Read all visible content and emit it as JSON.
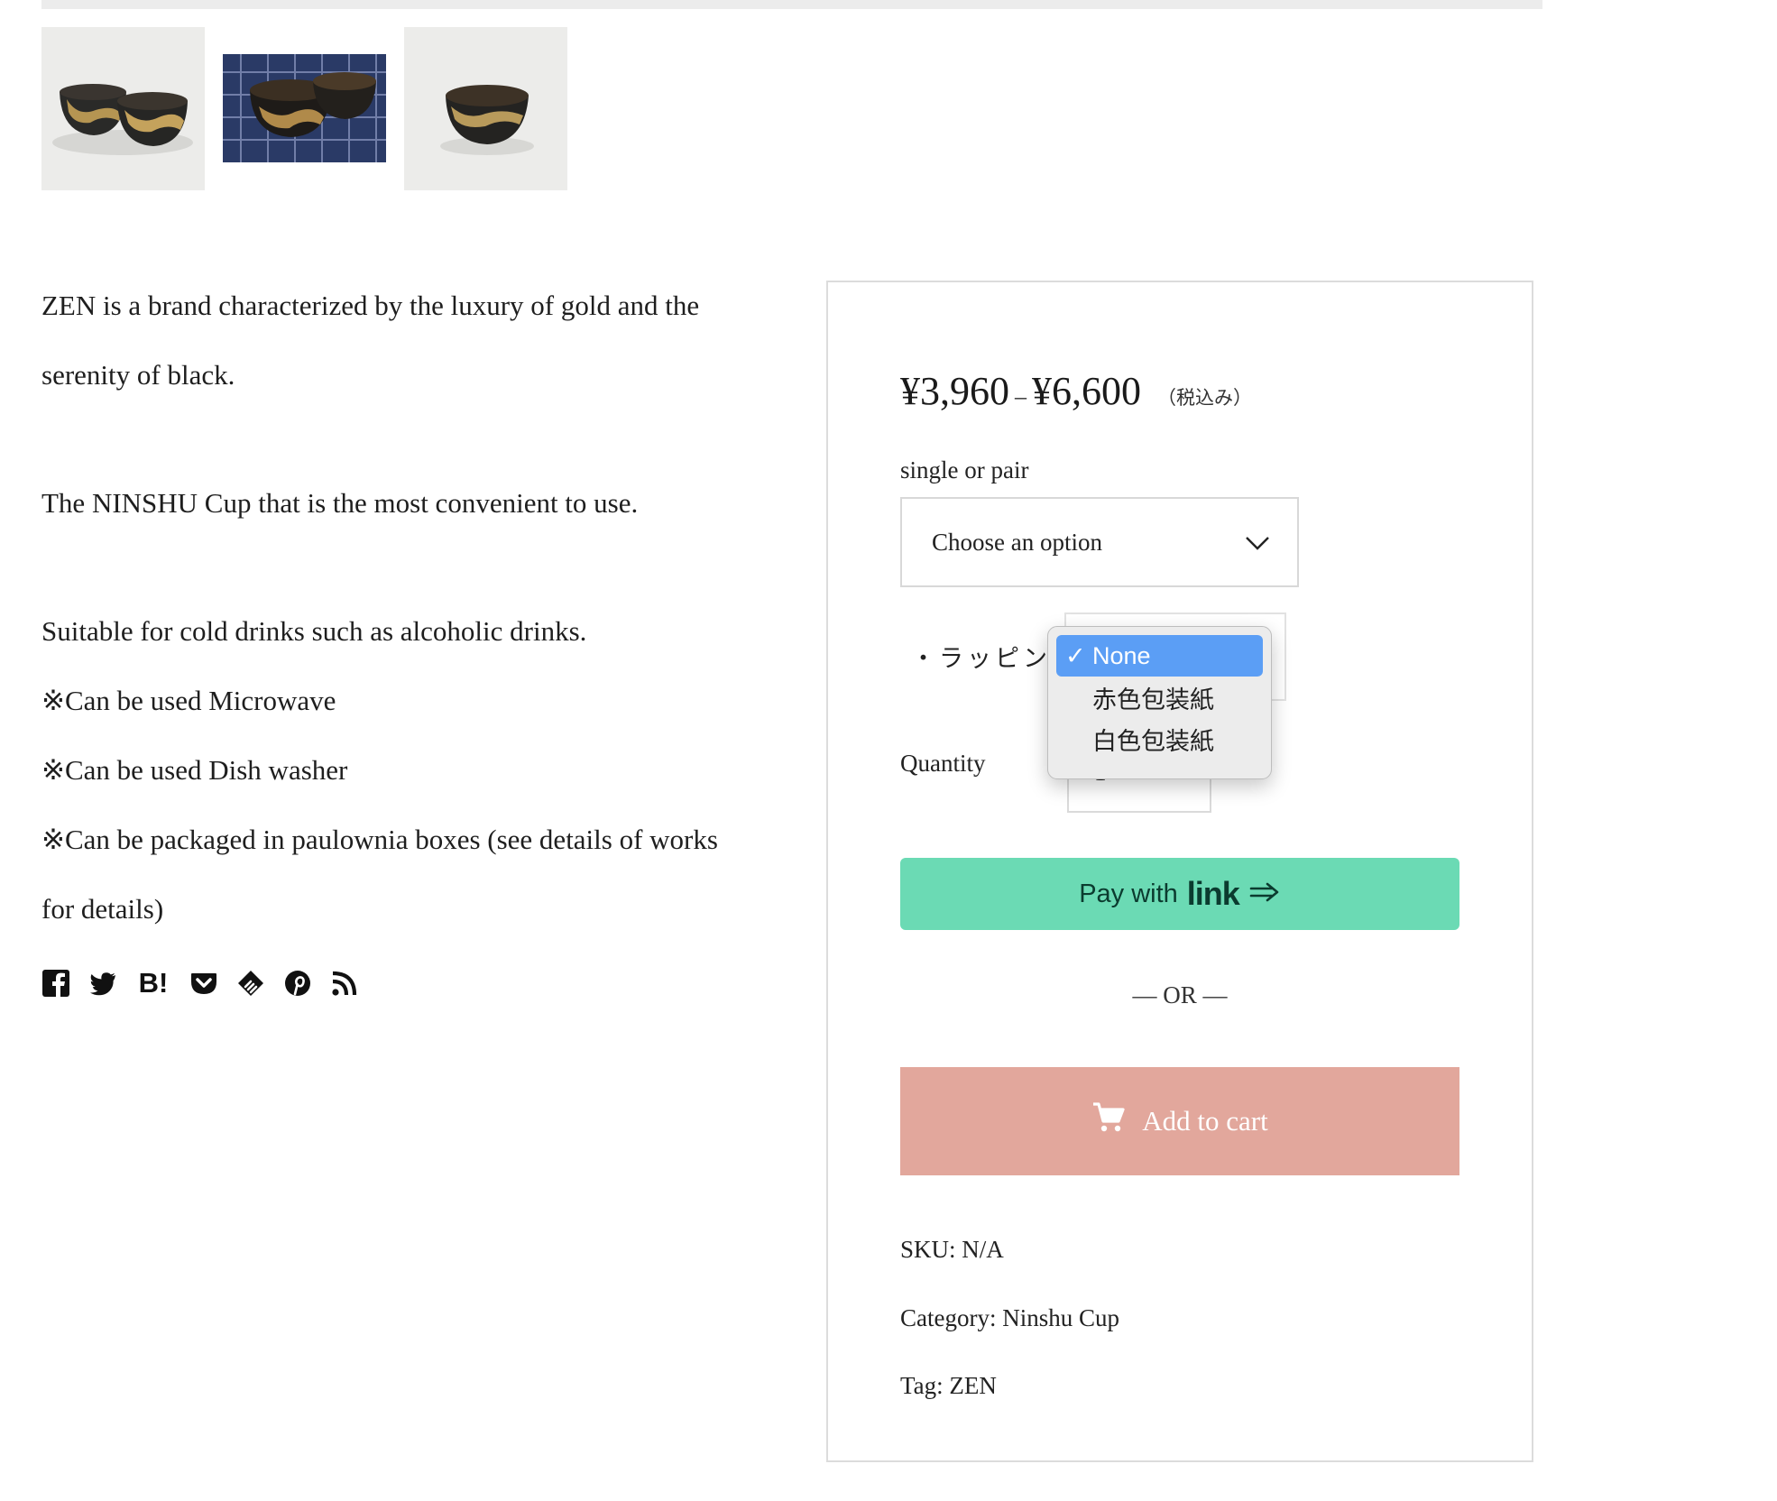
{
  "description": {
    "line1": "ZEN is a brand characterized by the luxury of gold and the",
    "line2": "serenity of black.",
    "line3": "The NINSHU Cup that is the most convenient to use.",
    "line4": "Suitable for cold drinks such as alcoholic drinks.",
    "line5": "※Can be used Microwave",
    "line6": "※Can be used Dish washer",
    "line7": "※Can be packaged in paulownia boxes (see details of works",
    "line8": "for details)"
  },
  "share_icons": [
    "facebook-icon",
    "twitter-icon",
    "hatena-bookmark-icon",
    "pocket-icon",
    "feedly-icon",
    "pinterest-icon",
    "rss-icon"
  ],
  "share": {
    "hatena_text": "B!"
  },
  "product": {
    "price_min": "¥3,960",
    "price_sep": "–",
    "price_max": "¥6,600",
    "tax_note": "（税込み）",
    "variant_label": "single or pair",
    "variant_placeholder": "Choose an option",
    "wrapping_label": "・ラッピング",
    "wrapping_options": [
      "None",
      "赤色包装紙",
      "白色包装紙"
    ],
    "wrapping_selected": "None",
    "checkmark": "✓",
    "quantity_label": "Quantity",
    "quantity_value": "1",
    "paylink_text": "Pay with",
    "paylink_brand": "link",
    "or_text": "— OR —",
    "add_to_cart": "Add to cart",
    "sku": "SKU: N/A",
    "category": "Category: Ninshu Cup",
    "tag": "Tag: ZEN"
  },
  "colors": {
    "paylink_bg": "#6bdab4",
    "cart_bg": "#e2a79c",
    "dropdown_selected": "#5b9ef5"
  }
}
